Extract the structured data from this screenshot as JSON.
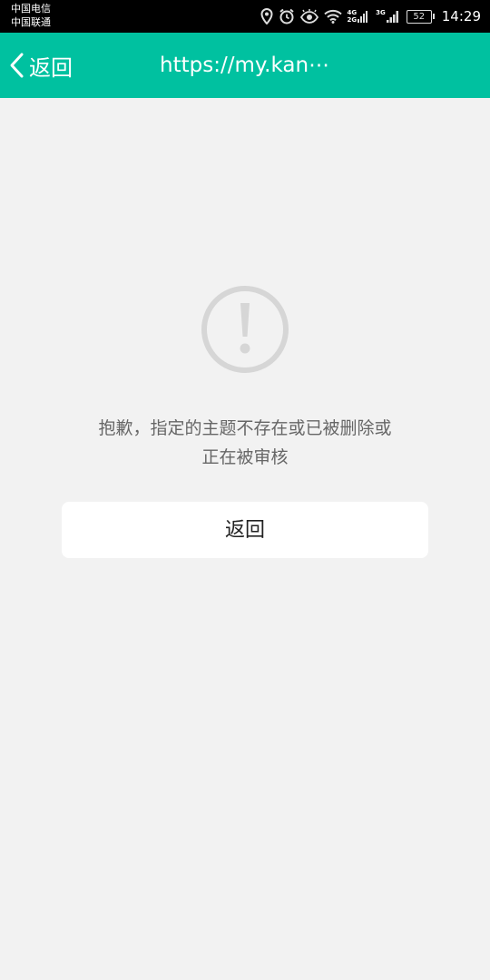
{
  "status_bar": {
    "carrier_1": "中国电信",
    "carrier_2": "中国联通",
    "network_1": "4G",
    "network_1b": "2G",
    "network_2": "3G",
    "battery": "52",
    "time": "14:29"
  },
  "nav": {
    "back_label": "返回",
    "title": "https://my.kan⋯"
  },
  "error": {
    "line_1": "抱歉，指定的主题不存在或已被删除或",
    "line_2": "正在被审核",
    "icon": "exclamation-circle-icon"
  },
  "actions": {
    "return_label": "返回"
  },
  "colors": {
    "nav_background": "#00c1a0",
    "page_background": "#f2f2f2",
    "icon_gray": "#d6d6d6"
  }
}
